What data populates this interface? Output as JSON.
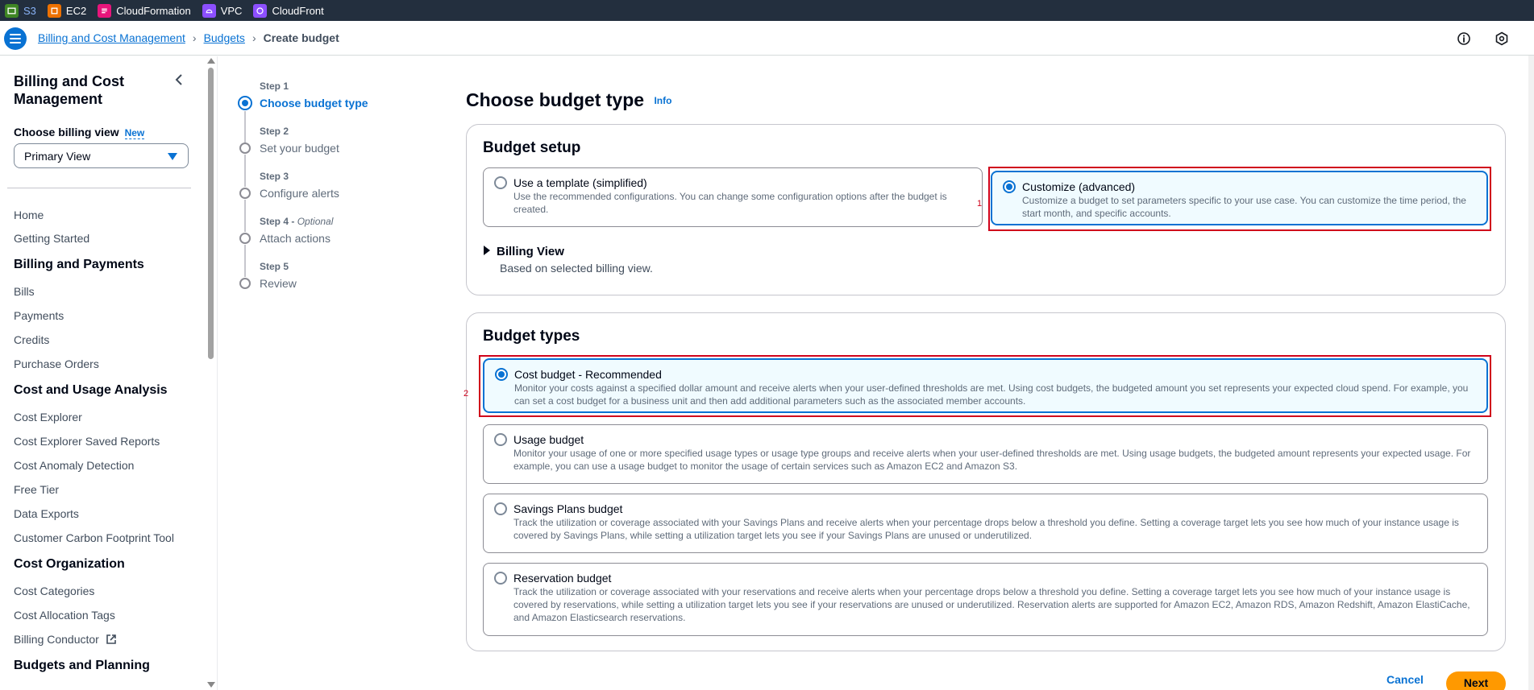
{
  "services": [
    {
      "label": "S3",
      "color": "#3f8624",
      "icon": "s3-icon"
    },
    {
      "label": "EC2",
      "color": "#ed7100",
      "icon": "ec2-icon"
    },
    {
      "label": "CloudFormation",
      "color": "#e7157b",
      "icon": "cloudformation-icon"
    },
    {
      "label": "VPC",
      "color": "#8c4fff",
      "icon": "vpc-icon"
    },
    {
      "label": "CloudFront",
      "color": "#8c4fff",
      "icon": "cloudfront-icon"
    }
  ],
  "breadcrumbs": {
    "root": "Billing and Cost Management",
    "parent": "Budgets",
    "current": "Create budget"
  },
  "sidebar": {
    "title": "Billing and Cost Management",
    "billing_view_label": "Choose billing view",
    "billing_view_badge": "New",
    "billing_view_value": "Primary View",
    "items": [
      {
        "label": "Home"
      },
      {
        "label": "Getting Started"
      },
      {
        "label": "Billing and Payments",
        "section": true
      },
      {
        "label": "Bills"
      },
      {
        "label": "Payments"
      },
      {
        "label": "Credits"
      },
      {
        "label": "Purchase Orders"
      },
      {
        "label": "Cost and Usage Analysis",
        "section": true
      },
      {
        "label": "Cost Explorer"
      },
      {
        "label": "Cost Explorer Saved Reports"
      },
      {
        "label": "Cost Anomaly Detection"
      },
      {
        "label": "Free Tier"
      },
      {
        "label": "Data Exports"
      },
      {
        "label": "Customer Carbon Footprint Tool"
      },
      {
        "label": "Cost Organization",
        "section": true
      },
      {
        "label": "Cost Categories"
      },
      {
        "label": "Cost Allocation Tags"
      },
      {
        "label": "Billing Conductor",
        "external": true
      },
      {
        "label": "Budgets and Planning",
        "section": true
      }
    ]
  },
  "steps": [
    {
      "label": "Step 1",
      "title": "Choose budget type",
      "active": true
    },
    {
      "label": "Step 2",
      "title": "Set your budget"
    },
    {
      "label": "Step 3",
      "title": "Configure alerts"
    },
    {
      "label": "Step 4",
      "optional": "Optional",
      "title": "Attach actions"
    },
    {
      "label": "Step 5",
      "title": "Review"
    }
  ],
  "main": {
    "title": "Choose budget type",
    "info_link": "Info",
    "setup": {
      "heading": "Budget setup",
      "template_title": "Use a template (simplified)",
      "template_desc": "Use the recommended configurations. You can change some configuration options after the budget is created.",
      "custom_title": "Customize (advanced)",
      "custom_desc": "Customize a budget to set parameters specific to your use case. You can customize the time period, the start month, and specific accounts.",
      "billing_view_heading": "Billing View",
      "billing_view_desc": "Based on selected billing view."
    },
    "types": {
      "heading": "Budget types",
      "cost_title": "Cost budget - Recommended",
      "cost_desc": "Monitor your costs against a specified dollar amount and receive alerts when your user-defined thresholds are met. Using cost budgets, the budgeted amount you set represents your expected cloud spend. For example, you can set a cost budget for a business unit and then add additional parameters such as the associated member accounts.",
      "usage_title": "Usage budget",
      "usage_desc": "Monitor your usage of one or more specified usage types or usage type groups and receive alerts when your user-defined thresholds are met. Using usage budgets, the budgeted amount represents your expected usage. For example, you can use a usage budget to monitor the usage of certain services such as Amazon EC2 and Amazon S3.",
      "savings_title": "Savings Plans budget",
      "savings_desc": "Track the utilization or coverage associated with your Savings Plans and receive alerts when your percentage drops below a threshold you define. Setting a coverage target lets you see how much of your instance usage is covered by Savings Plans, while setting a utilization target lets you see if your Savings Plans are unused or underutilized.",
      "reservation_title": "Reservation budget",
      "reservation_desc": "Track the utilization or coverage associated with your reservations and receive alerts when your percentage drops below a threshold you define. Setting a coverage target lets you see how much of your instance usage is covered by reservations, while setting a utilization target lets you see if your reservations are unused or underutilized. Reservation alerts are supported for Amazon EC2, Amazon RDS, Amazon Redshift, Amazon ElastiCache, and Amazon Elasticsearch reservations."
    },
    "annotations": {
      "one": "1",
      "two": "2"
    },
    "cancel_label": "Cancel",
    "next_label": "Next"
  }
}
